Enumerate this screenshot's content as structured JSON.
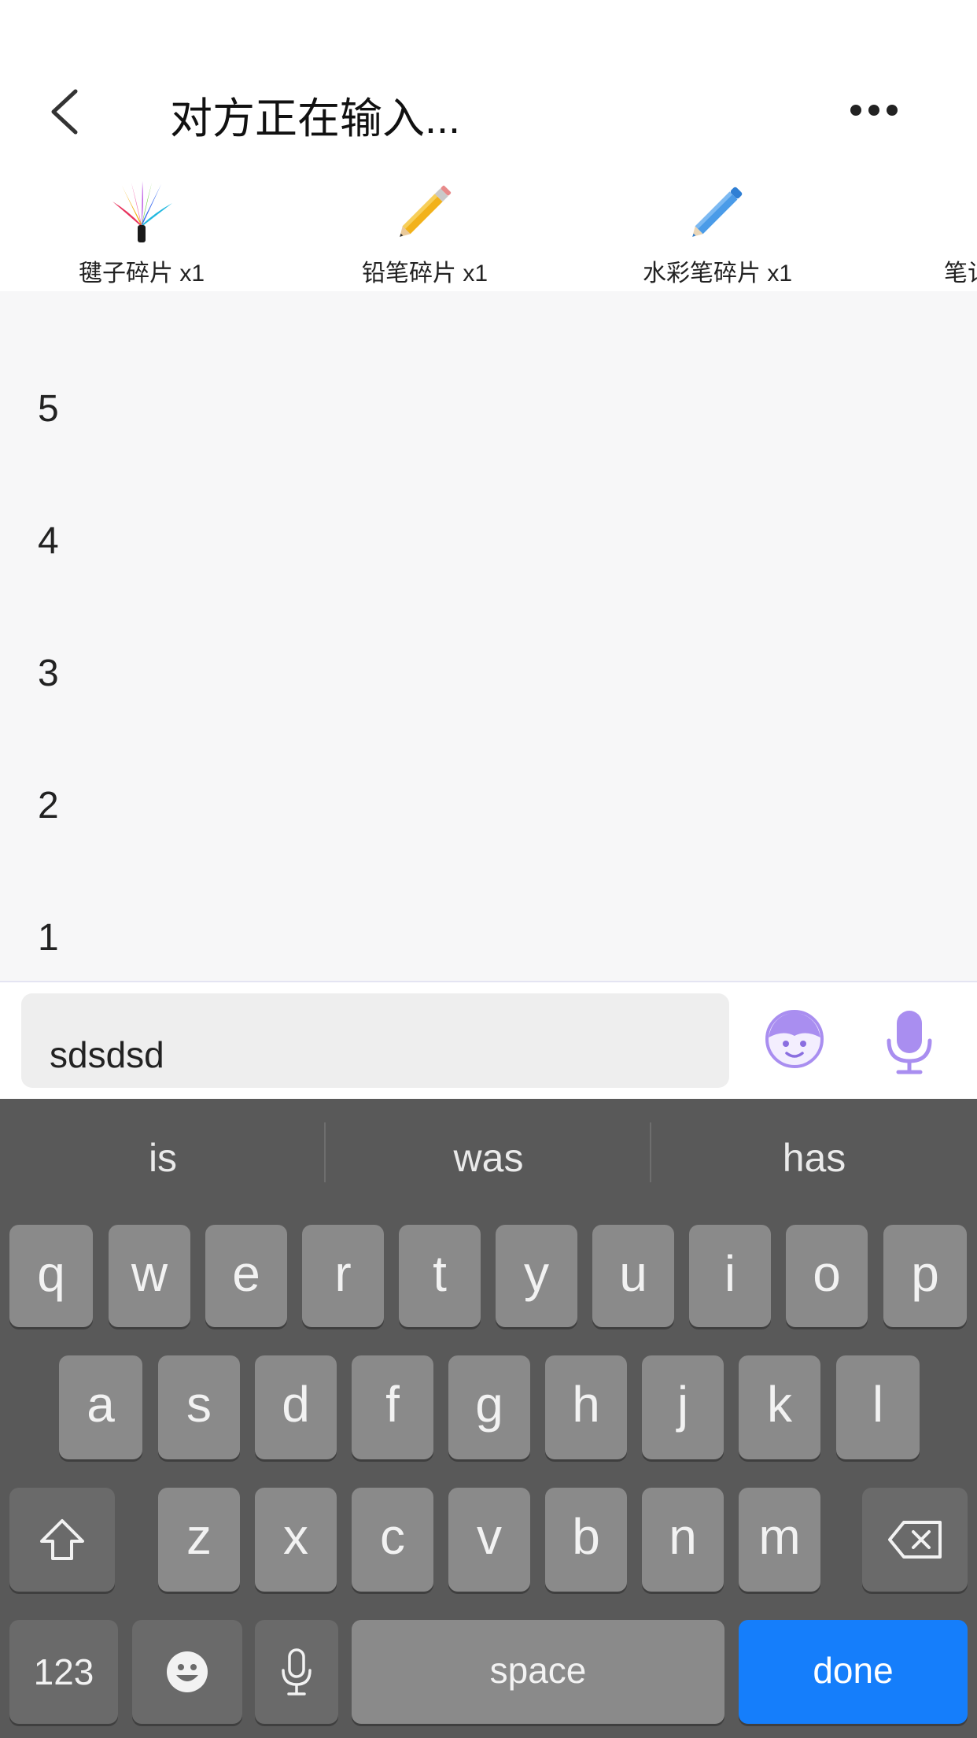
{
  "header": {
    "title": "对方正在输入...",
    "back_icon": "chevron-left-icon",
    "more_icon": "ellipsis-icon"
  },
  "gifts": [
    {
      "label": "毽子碎片 x1",
      "icon": "shuttlecock-icon"
    },
    {
      "label": "铅笔碎片 x1",
      "icon": "pencil-icon"
    },
    {
      "label": "水彩笔碎片 x1",
      "icon": "watercolor-pen-icon"
    },
    {
      "label": "笔记"
    }
  ],
  "messages": [
    "5",
    "4",
    "3",
    "2",
    "1"
  ],
  "input": {
    "value": "sdsdsd",
    "emoji_icon": "face-icon",
    "voice_icon": "microphone-icon"
  },
  "keyboard": {
    "suggestions": [
      "is",
      "was",
      "has"
    ],
    "row1": [
      "q",
      "w",
      "e",
      "r",
      "t",
      "y",
      "u",
      "i",
      "o",
      "p"
    ],
    "row2": [
      "a",
      "s",
      "d",
      "f",
      "g",
      "h",
      "j",
      "k",
      "l"
    ],
    "row3": [
      "z",
      "x",
      "c",
      "v",
      "b",
      "n",
      "m"
    ],
    "numbers_label": "123",
    "space_label": "space",
    "done_label": "done",
    "accent_color": "#157efb"
  }
}
